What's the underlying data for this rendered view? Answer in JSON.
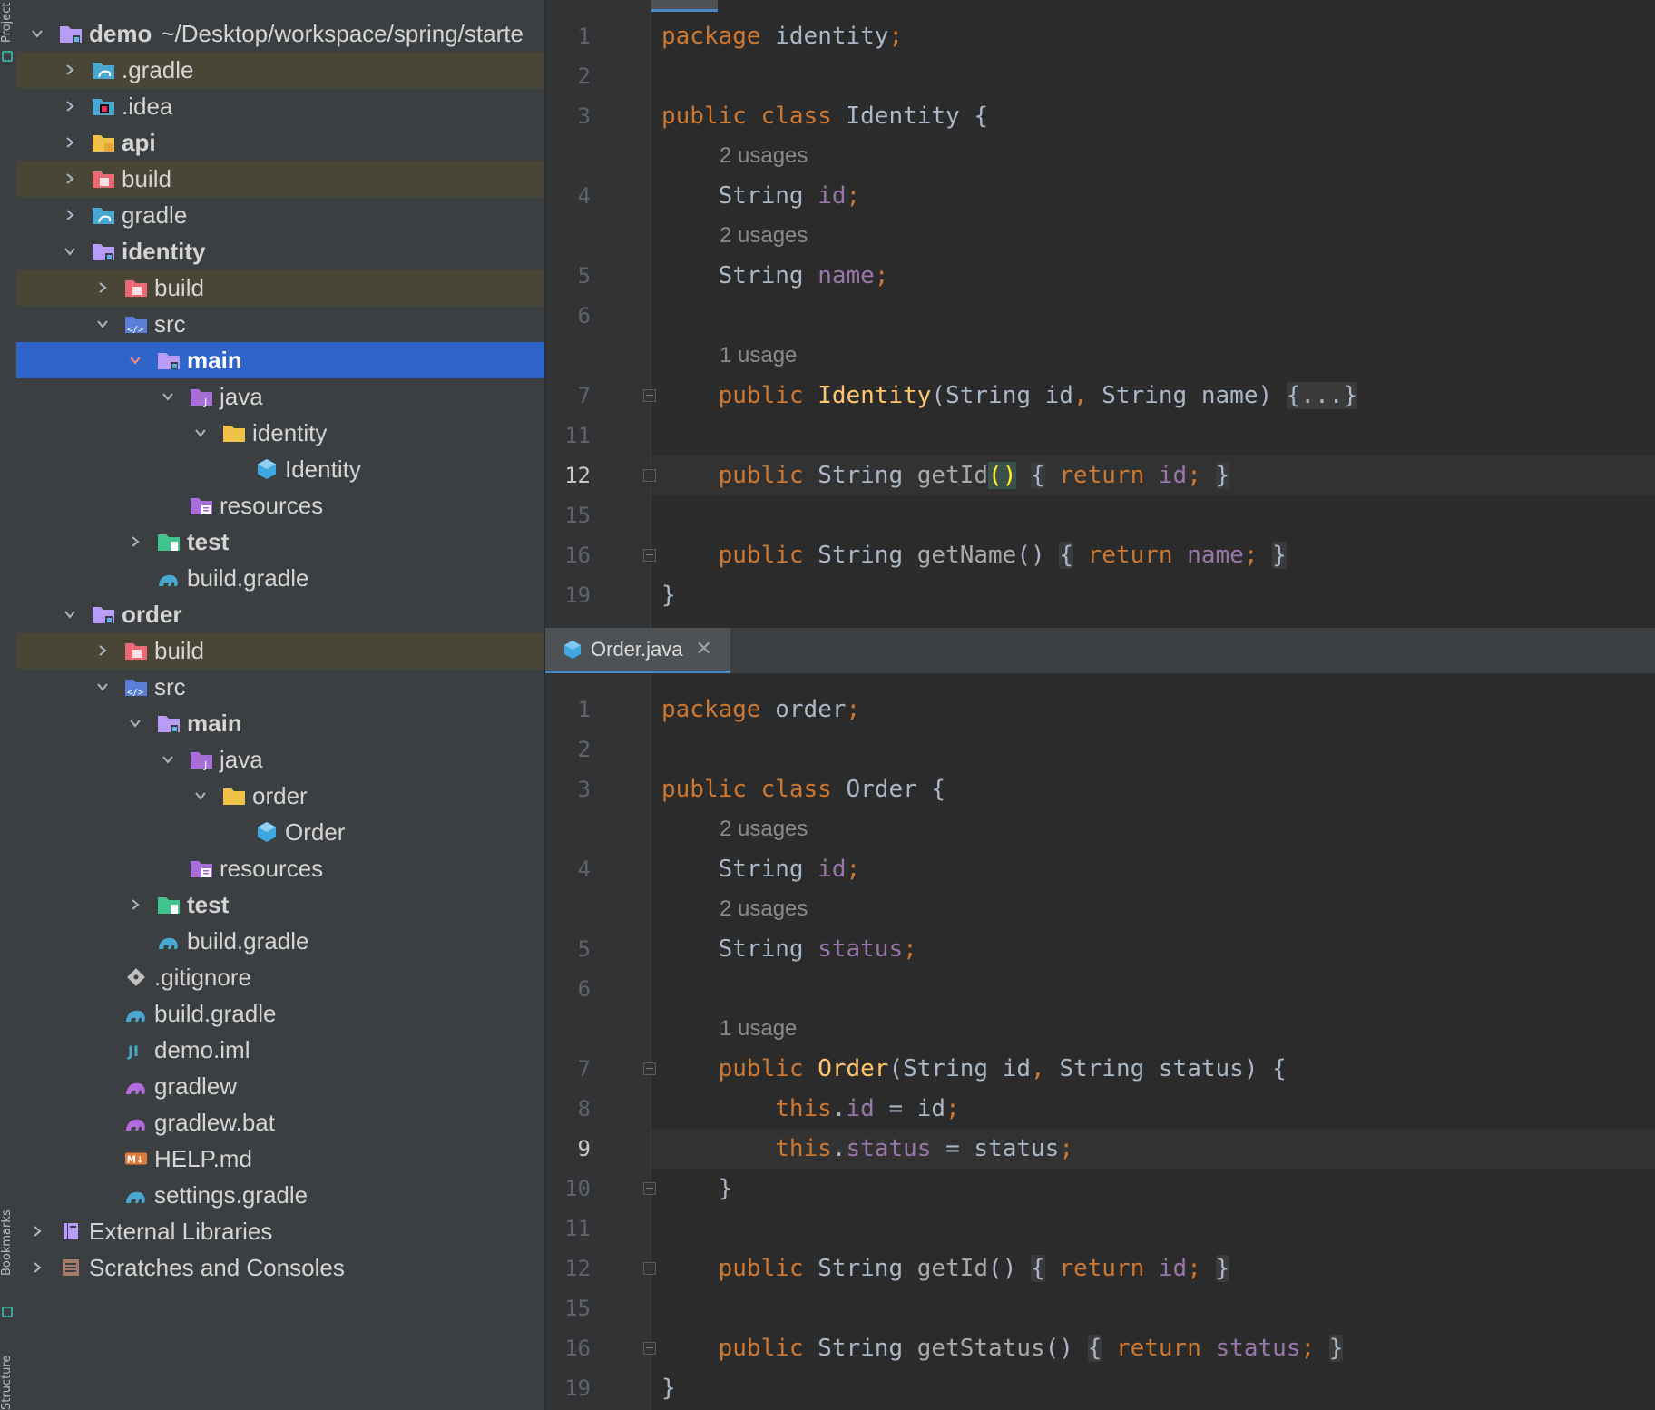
{
  "sidebar": {
    "project_label": "Project",
    "bookmarks_label": "Bookmarks",
    "structure_label": "Structure"
  },
  "tree": [
    {
      "label": "demo",
      "path": "~/Desktop/workspace/spring/starte",
      "bold": true,
      "level": 0,
      "chev": "down",
      "icon": "module-folder"
    },
    {
      "label": ".gradle",
      "level": 1,
      "chev": "right",
      "icon": "gradle-folder",
      "excluded": true
    },
    {
      "label": ".idea",
      "level": 1,
      "chev": "right",
      "icon": "idea-folder"
    },
    {
      "label": "api",
      "bold": true,
      "level": 1,
      "chev": "right",
      "icon": "module-folder-yellow"
    },
    {
      "label": "build",
      "level": 1,
      "chev": "right",
      "icon": "excluded-folder",
      "excluded": true
    },
    {
      "label": "gradle",
      "level": 1,
      "chev": "right",
      "icon": "gradle-folder"
    },
    {
      "label": "identity",
      "bold": true,
      "level": 1,
      "chev": "down",
      "icon": "module-folder"
    },
    {
      "label": "build",
      "level": 2,
      "chev": "right",
      "icon": "excluded-folder",
      "excluded": true
    },
    {
      "label": "src",
      "level": 2,
      "chev": "down",
      "icon": "source-folder"
    },
    {
      "label": "main",
      "bold": true,
      "level": 3,
      "chev": "down",
      "icon": "module-folder",
      "selected": true
    },
    {
      "label": "java",
      "level": 4,
      "chev": "down",
      "icon": "java-root-folder"
    },
    {
      "label": "identity",
      "level": 5,
      "chev": "down",
      "icon": "package-folder"
    },
    {
      "label": "Identity",
      "level": 6,
      "chev": "none",
      "icon": "java-class"
    },
    {
      "label": "resources",
      "level": 4,
      "chev": "none",
      "icon": "resources-folder"
    },
    {
      "label": "test",
      "bold": true,
      "level": 3,
      "chev": "right",
      "icon": "test-folder"
    },
    {
      "label": "build.gradle",
      "level": 3,
      "chev": "none",
      "icon": "gradle-file"
    },
    {
      "label": "order",
      "bold": true,
      "level": 1,
      "chev": "down",
      "icon": "module-folder"
    },
    {
      "label": "build",
      "level": 2,
      "chev": "right",
      "icon": "excluded-folder",
      "excluded": true
    },
    {
      "label": "src",
      "level": 2,
      "chev": "down",
      "icon": "source-folder"
    },
    {
      "label": "main",
      "bold": true,
      "level": 3,
      "chev": "down",
      "icon": "module-folder"
    },
    {
      "label": "java",
      "level": 4,
      "chev": "down",
      "icon": "java-root-folder"
    },
    {
      "label": "order",
      "level": 5,
      "chev": "down",
      "icon": "package-folder"
    },
    {
      "label": "Order",
      "level": 6,
      "chev": "none",
      "icon": "java-class"
    },
    {
      "label": "resources",
      "level": 4,
      "chev": "none",
      "icon": "resources-folder"
    },
    {
      "label": "test",
      "bold": true,
      "level": 3,
      "chev": "right",
      "icon": "test-folder"
    },
    {
      "label": "build.gradle",
      "level": 3,
      "chev": "none",
      "icon": "gradle-file"
    },
    {
      "label": ".gitignore",
      "level": 2,
      "chev": "none",
      "icon": "git-file"
    },
    {
      "label": "build.gradle",
      "level": 2,
      "chev": "none",
      "icon": "gradle-file"
    },
    {
      "label": "demo.iml",
      "level": 2,
      "chev": "none",
      "icon": "iml-file"
    },
    {
      "label": "gradlew",
      "level": 2,
      "chev": "none",
      "icon": "gradlew-file"
    },
    {
      "label": "gradlew.bat",
      "level": 2,
      "chev": "none",
      "icon": "gradlew-file"
    },
    {
      "label": "HELP.md",
      "level": 2,
      "chev": "none",
      "icon": "markdown-file"
    },
    {
      "label": "settings.gradle",
      "level": 2,
      "chev": "none",
      "icon": "gradle-file"
    },
    {
      "label": "External Libraries",
      "level": 0,
      "chev": "right",
      "icon": "libraries"
    },
    {
      "label": "Scratches and Consoles",
      "level": 0,
      "chev": "right",
      "icon": "scratches"
    }
  ],
  "editor_top": {
    "lines": [
      {
        "n": "1",
        "y": 0,
        "tokens": [
          [
            "kw",
            "package "
          ],
          [
            "",
            "identity"
          ],
          [
            "kw",
            ";"
          ]
        ]
      },
      {
        "n": "2",
        "y": 1,
        "tokens": []
      },
      {
        "n": "3",
        "y": 2,
        "tokens": [
          [
            "kw",
            "public class "
          ],
          [
            "",
            "Identity {"
          ]
        ]
      },
      {
        "hint": "2 usages",
        "y": 3
      },
      {
        "n": "4",
        "y": 4,
        "tokens": [
          [
            "",
            "    String "
          ],
          [
            "fld",
            "id"
          ],
          [
            "kw",
            ";"
          ]
        ]
      },
      {
        "hint": "2 usages",
        "y": 5
      },
      {
        "n": "5",
        "y": 6,
        "tokens": [
          [
            "",
            "    String "
          ],
          [
            "fld",
            "name"
          ],
          [
            "kw",
            ";"
          ]
        ]
      },
      {
        "n": "6",
        "y": 7,
        "tokens": []
      },
      {
        "hint": "1 usage",
        "y": 8
      },
      {
        "n": "7",
        "y": 9,
        "fold": true,
        "tokens": [
          [
            "kw",
            "    public "
          ],
          [
            "mth",
            "Identity"
          ],
          [
            "",
            "(String id"
          ],
          [
            "kw",
            ", "
          ],
          [
            "",
            "String name) "
          ],
          [
            "fold",
            "{...}"
          ]
        ]
      },
      {
        "n": "11",
        "y": 10,
        "tokens": []
      },
      {
        "n": "12",
        "y": 11,
        "cur": true,
        "fold": true,
        "tokens": [
          [
            "kw",
            "    public "
          ],
          [
            "",
            "String "
          ],
          [
            "call",
            "getId"
          ],
          [
            "paren-match",
            "()"
          ],
          [
            "",
            " "
          ],
          [
            "fold",
            "{"
          ],
          [
            "",
            " "
          ],
          [
            "kw",
            "return "
          ],
          [
            "fld",
            "id"
          ],
          [
            "kw",
            ";"
          ],
          [
            "",
            " "
          ],
          [
            "fold",
            "}"
          ]
        ]
      },
      {
        "n": "15",
        "y": 12,
        "tokens": []
      },
      {
        "n": "16",
        "y": 13,
        "fold": true,
        "tokens": [
          [
            "kw",
            "    public "
          ],
          [
            "",
            "String "
          ],
          [
            "call",
            "getName"
          ],
          [
            "",
            "()"
          ],
          [
            "",
            " "
          ],
          [
            "fold",
            "{"
          ],
          [
            "",
            " "
          ],
          [
            "kw",
            "return "
          ],
          [
            "fld",
            "name"
          ],
          [
            "kw",
            ";"
          ],
          [
            "",
            " "
          ],
          [
            "fold",
            "}"
          ]
        ]
      },
      {
        "n": "19",
        "y": 14,
        "tokens": [
          [
            "",
            "}"
          ]
        ]
      }
    ]
  },
  "editor_bottom": {
    "tab_label": "Order.java",
    "lines": [
      {
        "n": "1",
        "y": 0,
        "tokens": [
          [
            "kw",
            "package "
          ],
          [
            "",
            "order"
          ],
          [
            "kw",
            ";"
          ]
        ]
      },
      {
        "n": "2",
        "y": 1,
        "tokens": []
      },
      {
        "n": "3",
        "y": 2,
        "tokens": [
          [
            "kw",
            "public class "
          ],
          [
            "",
            "Order {"
          ]
        ]
      },
      {
        "hint": "2 usages",
        "y": 3
      },
      {
        "n": "4",
        "y": 4,
        "tokens": [
          [
            "",
            "    String "
          ],
          [
            "fld",
            "id"
          ],
          [
            "kw",
            ";"
          ]
        ]
      },
      {
        "hint": "2 usages",
        "y": 5
      },
      {
        "n": "5",
        "y": 6,
        "tokens": [
          [
            "",
            "    String "
          ],
          [
            "fld",
            "status"
          ],
          [
            "kw",
            ";"
          ]
        ]
      },
      {
        "n": "6",
        "y": 7,
        "tokens": []
      },
      {
        "hint": "1 usage",
        "y": 8
      },
      {
        "n": "7",
        "y": 9,
        "fold": true,
        "tokens": [
          [
            "kw",
            "    public "
          ],
          [
            "mth",
            "Order"
          ],
          [
            "",
            "(String id"
          ],
          [
            "kw",
            ", "
          ],
          [
            "",
            "String status) {"
          ]
        ]
      },
      {
        "n": "8",
        "y": 10,
        "tokens": [
          [
            "kw",
            "        this"
          ],
          [
            "",
            "."
          ],
          [
            "fld",
            "id"
          ],
          [
            "",
            " = id"
          ],
          [
            "kw",
            ";"
          ]
        ]
      },
      {
        "n": "9",
        "y": 11,
        "cur": true,
        "tokens": [
          [
            "kw",
            "        this"
          ],
          [
            "",
            "."
          ],
          [
            "fld",
            "status"
          ],
          [
            "",
            " = status"
          ],
          [
            "kw",
            ";"
          ]
        ]
      },
      {
        "n": "10",
        "y": 12,
        "fold": true,
        "tokens": [
          [
            "",
            "    }"
          ]
        ]
      },
      {
        "n": "11",
        "y": 13,
        "tokens": []
      },
      {
        "n": "12",
        "y": 14,
        "fold": true,
        "tokens": [
          [
            "kw",
            "    public "
          ],
          [
            "",
            "String "
          ],
          [
            "call",
            "getId"
          ],
          [
            "",
            "()"
          ],
          [
            "",
            " "
          ],
          [
            "fold",
            "{"
          ],
          [
            "",
            " "
          ],
          [
            "kw",
            "return "
          ],
          [
            "fld",
            "id"
          ],
          [
            "kw",
            ";"
          ],
          [
            "",
            " "
          ],
          [
            "fold",
            "}"
          ]
        ]
      },
      {
        "n": "15",
        "y": 15,
        "tokens": []
      },
      {
        "n": "16",
        "y": 16,
        "fold": true,
        "tokens": [
          [
            "kw",
            "    public "
          ],
          [
            "",
            "String "
          ],
          [
            "call",
            "getStatus"
          ],
          [
            "",
            "()"
          ],
          [
            "",
            " "
          ],
          [
            "fold",
            "{"
          ],
          [
            "",
            " "
          ],
          [
            "kw",
            "return "
          ],
          [
            "fld",
            "status"
          ],
          [
            "kw",
            ";"
          ],
          [
            "",
            " "
          ],
          [
            "fold",
            "}"
          ]
        ]
      },
      {
        "n": "19",
        "y": 17,
        "tokens": [
          [
            "",
            "}"
          ]
        ]
      }
    ]
  },
  "colors": {
    "keyword": "#cc7832",
    "field": "#9876aa",
    "method": "#ffc66d",
    "selection": "#2f65ca",
    "excluded_row": "#4a4637"
  }
}
